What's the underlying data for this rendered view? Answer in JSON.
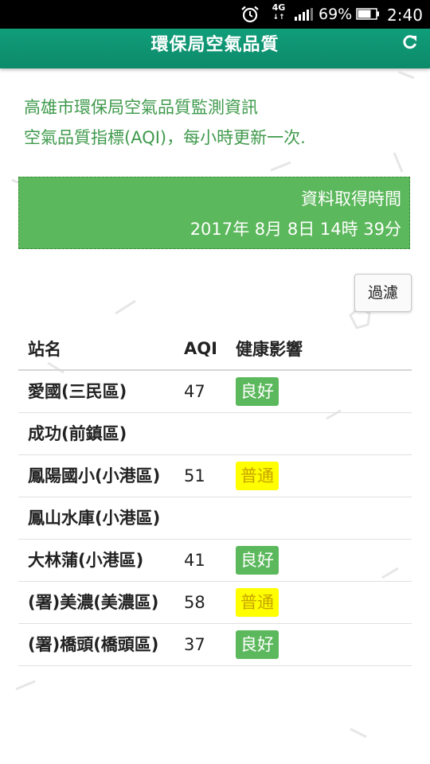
{
  "status_bar": {
    "network_label": "4G",
    "battery_percent": "69%",
    "time": "2:40",
    "icons": [
      "alarm-clock-icon",
      "mobile-data-icon",
      "signal-icon",
      "battery-icon"
    ]
  },
  "app_bar": {
    "title": "環保局空氣品質",
    "refresh_icon": "refresh-icon",
    "color": "#0f9a74"
  },
  "intro": {
    "line1": "高雄市環保局空氣品質監測資訊",
    "line2": "空氣品質指標(AQI)，每小時更新一次."
  },
  "fetch_time": {
    "label": "資料取得時間",
    "value": "2017年 8月 8日 14時 39分"
  },
  "filter_label": "過濾",
  "table": {
    "headers": {
      "station": "站名",
      "aqi": "AQI",
      "health": "健康影響"
    },
    "rows": [
      {
        "station": "愛國(三民區)",
        "aqi": "47",
        "health": "良好",
        "level": "good"
      },
      {
        "station": "成功(前鎮區)",
        "aqi": "",
        "health": "",
        "level": ""
      },
      {
        "station": "鳳陽國小(小港區)",
        "aqi": "51",
        "health": "普通",
        "level": "moderate"
      },
      {
        "station": "鳳山水庫(小港區)",
        "aqi": "",
        "health": "",
        "level": ""
      },
      {
        "station": "大林蒲(小港區)",
        "aqi": "41",
        "health": "良好",
        "level": "good"
      },
      {
        "station": "(署)美濃(美濃區)",
        "aqi": "58",
        "health": "普通",
        "level": "moderate"
      },
      {
        "station": "(署)橋頭(橋頭區)",
        "aqi": "37",
        "health": "良好",
        "level": "good"
      }
    ]
  },
  "colors": {
    "good": "#5cb85c",
    "moderate": "#ffff00",
    "intro_text": "#3f9a4c"
  }
}
